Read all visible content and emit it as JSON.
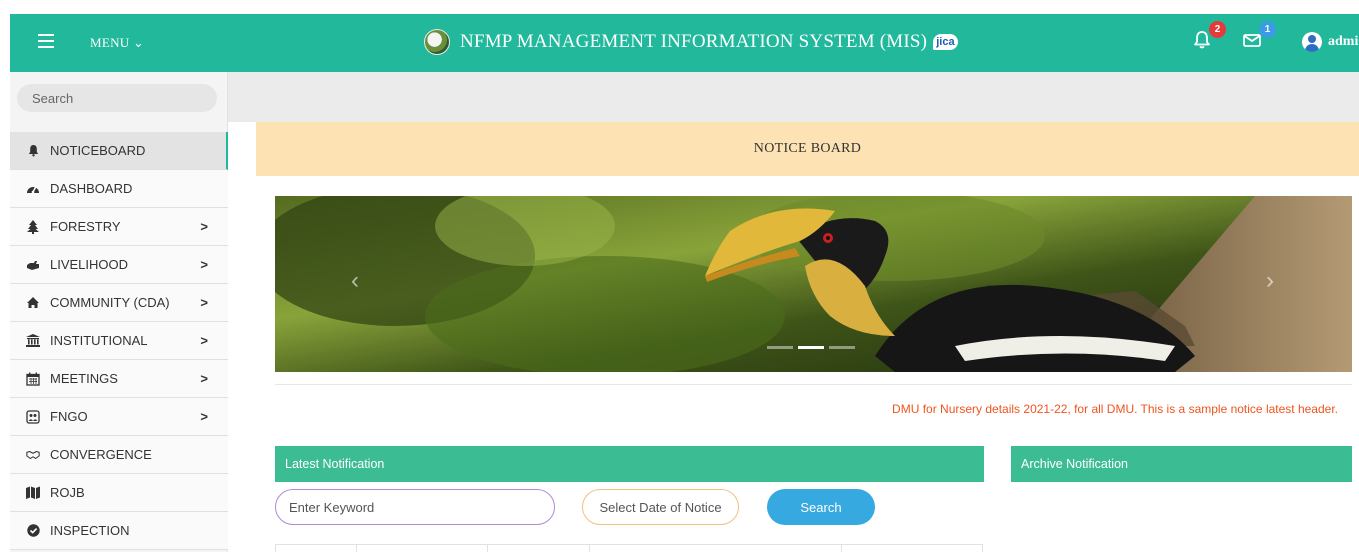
{
  "header": {
    "menu_label": "MENU ⌄",
    "title": "NFMP MANAGEMENT INFORMATION SYSTEM (MIS)",
    "partner_logo_text": "jica",
    "notification_count": "2",
    "message_count": "1",
    "user_name": "admi",
    "colors": {
      "bar": "#21b89c",
      "notif_badge": "#e53a3a",
      "message_badge": "#3a9ce5"
    }
  },
  "sidebar": {
    "search_placeholder": "Search",
    "items": [
      {
        "label": "NOTICEBOARD",
        "icon": "bell-icon",
        "active": true,
        "has_submenu": false
      },
      {
        "label": "DASHBOARD",
        "icon": "tachometer-icon",
        "active": false,
        "has_submenu": false
      },
      {
        "label": "FORESTRY",
        "icon": "tree-icon",
        "active": false,
        "has_submenu": true
      },
      {
        "label": "LIVELIHOOD",
        "icon": "hand-icon",
        "active": false,
        "has_submenu": true
      },
      {
        "label": "COMMUNITY (CDA)",
        "icon": "home-icon",
        "active": false,
        "has_submenu": true
      },
      {
        "label": "INSTITUTIONAL",
        "icon": "institution-icon",
        "active": false,
        "has_submenu": true
      },
      {
        "label": "MEETINGS",
        "icon": "calendar-icon",
        "active": false,
        "has_submenu": true
      },
      {
        "label": "FNGO",
        "icon": "group-icon",
        "active": false,
        "has_submenu": true
      },
      {
        "label": "CONVERGENCE",
        "icon": "handshake-icon",
        "active": false,
        "has_submenu": false
      },
      {
        "label": "ROJB",
        "icon": "map-icon",
        "active": false,
        "has_submenu": false
      },
      {
        "label": "INSPECTION",
        "icon": "check-circle-icon",
        "active": false,
        "has_submenu": false
      }
    ],
    "arrow": ">"
  },
  "main": {
    "notice_title": "NOTICE BOARD",
    "carousel": {
      "prev": "‹",
      "next": "›",
      "slide_count": 3,
      "active_slide": 2
    },
    "scrolling_notice": "DMU for Nursery details 2021-22, for all DMU. This is a sample notice latest header.",
    "latest_title": "Latest Notification",
    "archive_title": "Archive Notification",
    "keyword_placeholder": "Enter Keyword",
    "date_placeholder": "Select Date of Notice",
    "search_button": "Search",
    "colors": {
      "header_bg": "#fde3b4",
      "panel": "#3cbc93",
      "notice_text": "#f0541e",
      "button": "#36a9e1"
    }
  }
}
